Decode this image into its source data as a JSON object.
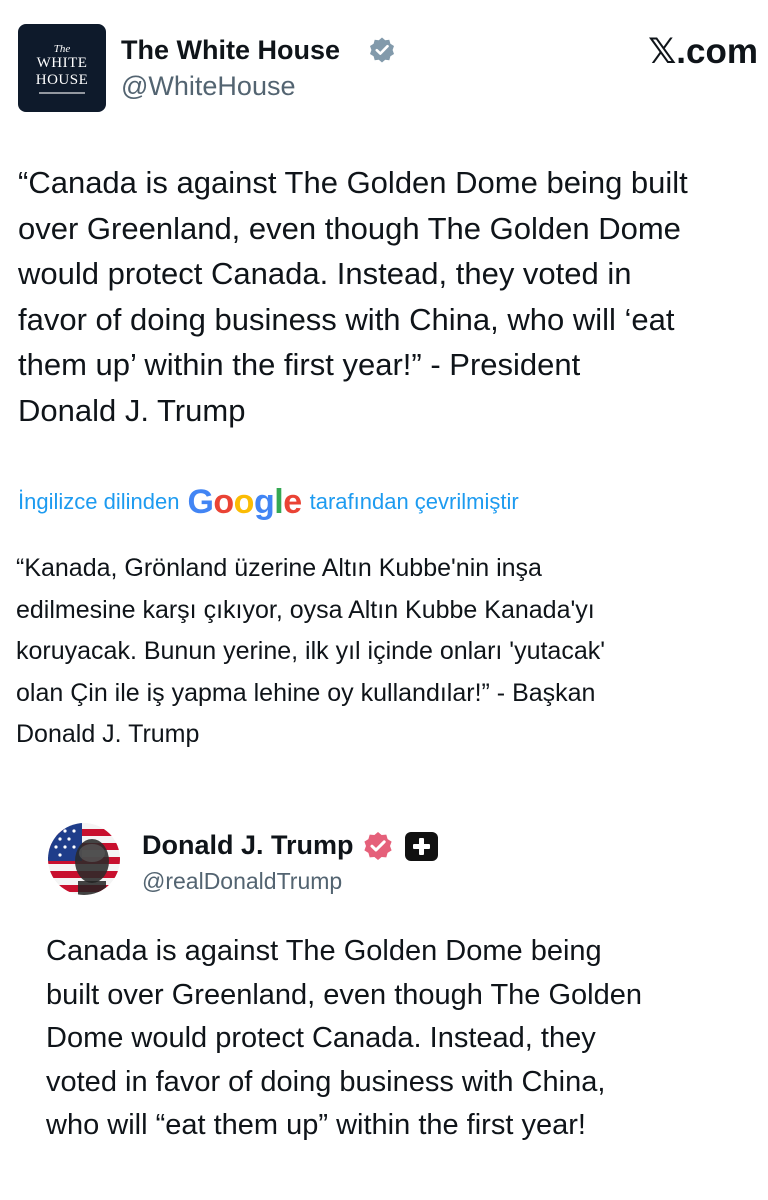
{
  "post": {
    "avatar_text_top": "The",
    "avatar_text_line1": "WHITE",
    "avatar_text_line2": "HOUSE",
    "display_name": "The White House",
    "handle": "@WhiteHouse",
    "verified_icon": "verified-gray-badge-icon",
    "site_label_mark": "𝕏",
    "site_label_suffix": ".com",
    "text": "“Canada is against The Golden Dome being built\nover Greenland, even though The Golden Dome\nwould protect Canada. Instead, they voted in\nfavor of doing business with China, who will ‘eat\nthem up’ within the first year!” - President\nDonald J. Trump"
  },
  "translation": {
    "prefix": "İngilizce dilinden",
    "logo_letters": [
      "G",
      "o",
      "o",
      "g",
      "l",
      "e"
    ],
    "suffix": "tarafından çevrilmiştir",
    "text": "“Kanada, Grönland üzerine Altın Kubbe'nin inşa\nedilmesine karşı çıkıyor, oysa Altın Kubbe Kanada'yı\nkoruyacak. Bunun yerine, ilk yıl içinde onları 'yutacak'\nolan Çin ile iş yapma lehine oy kullandılar!” - Başkan\nDonald J. Trump"
  },
  "quoted_post": {
    "display_name": "Donald J. Trump",
    "handle": "@realDonaldTrump",
    "verified_icon": "verified-gold-badge-icon",
    "extra_icon": "plus-badge-icon",
    "text": "Canada is against The Golden Dome being\nbuilt over Greenland, even though The Golden\nDome would protect Canada. Instead, they\nvoted in favor of doing business with China,\nwho will “eat them up” within the first year!"
  },
  "colors": {
    "link_blue": "#1d9bf0",
    "secondary_text": "#536471",
    "verified_gray": "#829aab",
    "verified_gold_pink": "#e5607a",
    "google_blue": "#4285f4",
    "google_red": "#ea4335",
    "google_yellow": "#fbbc05",
    "google_green": "#34a853"
  }
}
